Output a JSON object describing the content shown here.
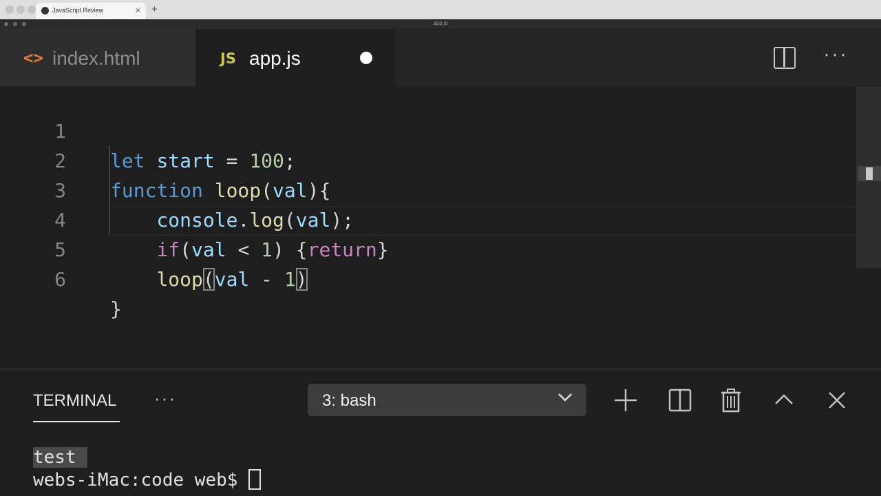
{
  "browser": {
    "tab_title": "JavaScript Review",
    "tab_close": "×",
    "new_tab": "+"
  },
  "window": {
    "title": "app.js"
  },
  "editor_tabs": [
    {
      "icon_glyph": "<>",
      "icon": "html-file-icon",
      "label": "index.html",
      "active": false
    },
    {
      "icon_glyph": "JS",
      "icon": "js-file-icon",
      "label": "app.js",
      "active": true,
      "unsaved": true
    }
  ],
  "editor_actions": {
    "more": "···"
  },
  "code": {
    "line_numbers": [
      "1",
      "2",
      "3",
      "4",
      "5",
      "6"
    ],
    "l1": {
      "kw": "let",
      "var": "start",
      "op": "=",
      "num": "100",
      "semi": ";"
    },
    "l2": {
      "kw": "function",
      "fn": "loop",
      "open": "(",
      "param": "val",
      "close": ")",
      "brace": "{"
    },
    "l3": {
      "obj": "console",
      "dot": ".",
      "fn": "log",
      "open": "(",
      "arg": "val",
      "close": ");"
    },
    "l4": {
      "kw": "if",
      "open": "(",
      "var": "val",
      "op": "<",
      "num": "1",
      "close": ")",
      "bopen": "{",
      "ret": "return",
      "bclose": "}"
    },
    "l5": {
      "fn": "loop",
      "open": "(",
      "var": "val",
      "op": "-",
      "num": "1",
      "close": ")"
    },
    "l6": {
      "brace": "}"
    }
  },
  "terminal": {
    "title": "TERMINAL",
    "more": "···",
    "shell_select": "3: bash",
    "output": [
      "test",
      "webs-iMac:code web$"
    ]
  },
  "colors": {
    "keyword": "#569cd6",
    "control": "#c586c0",
    "variable": "#9cdcfe",
    "function": "#dcdcaa",
    "number": "#b5cea8",
    "html_icon": "#e37933",
    "js_icon": "#cbcb41"
  }
}
